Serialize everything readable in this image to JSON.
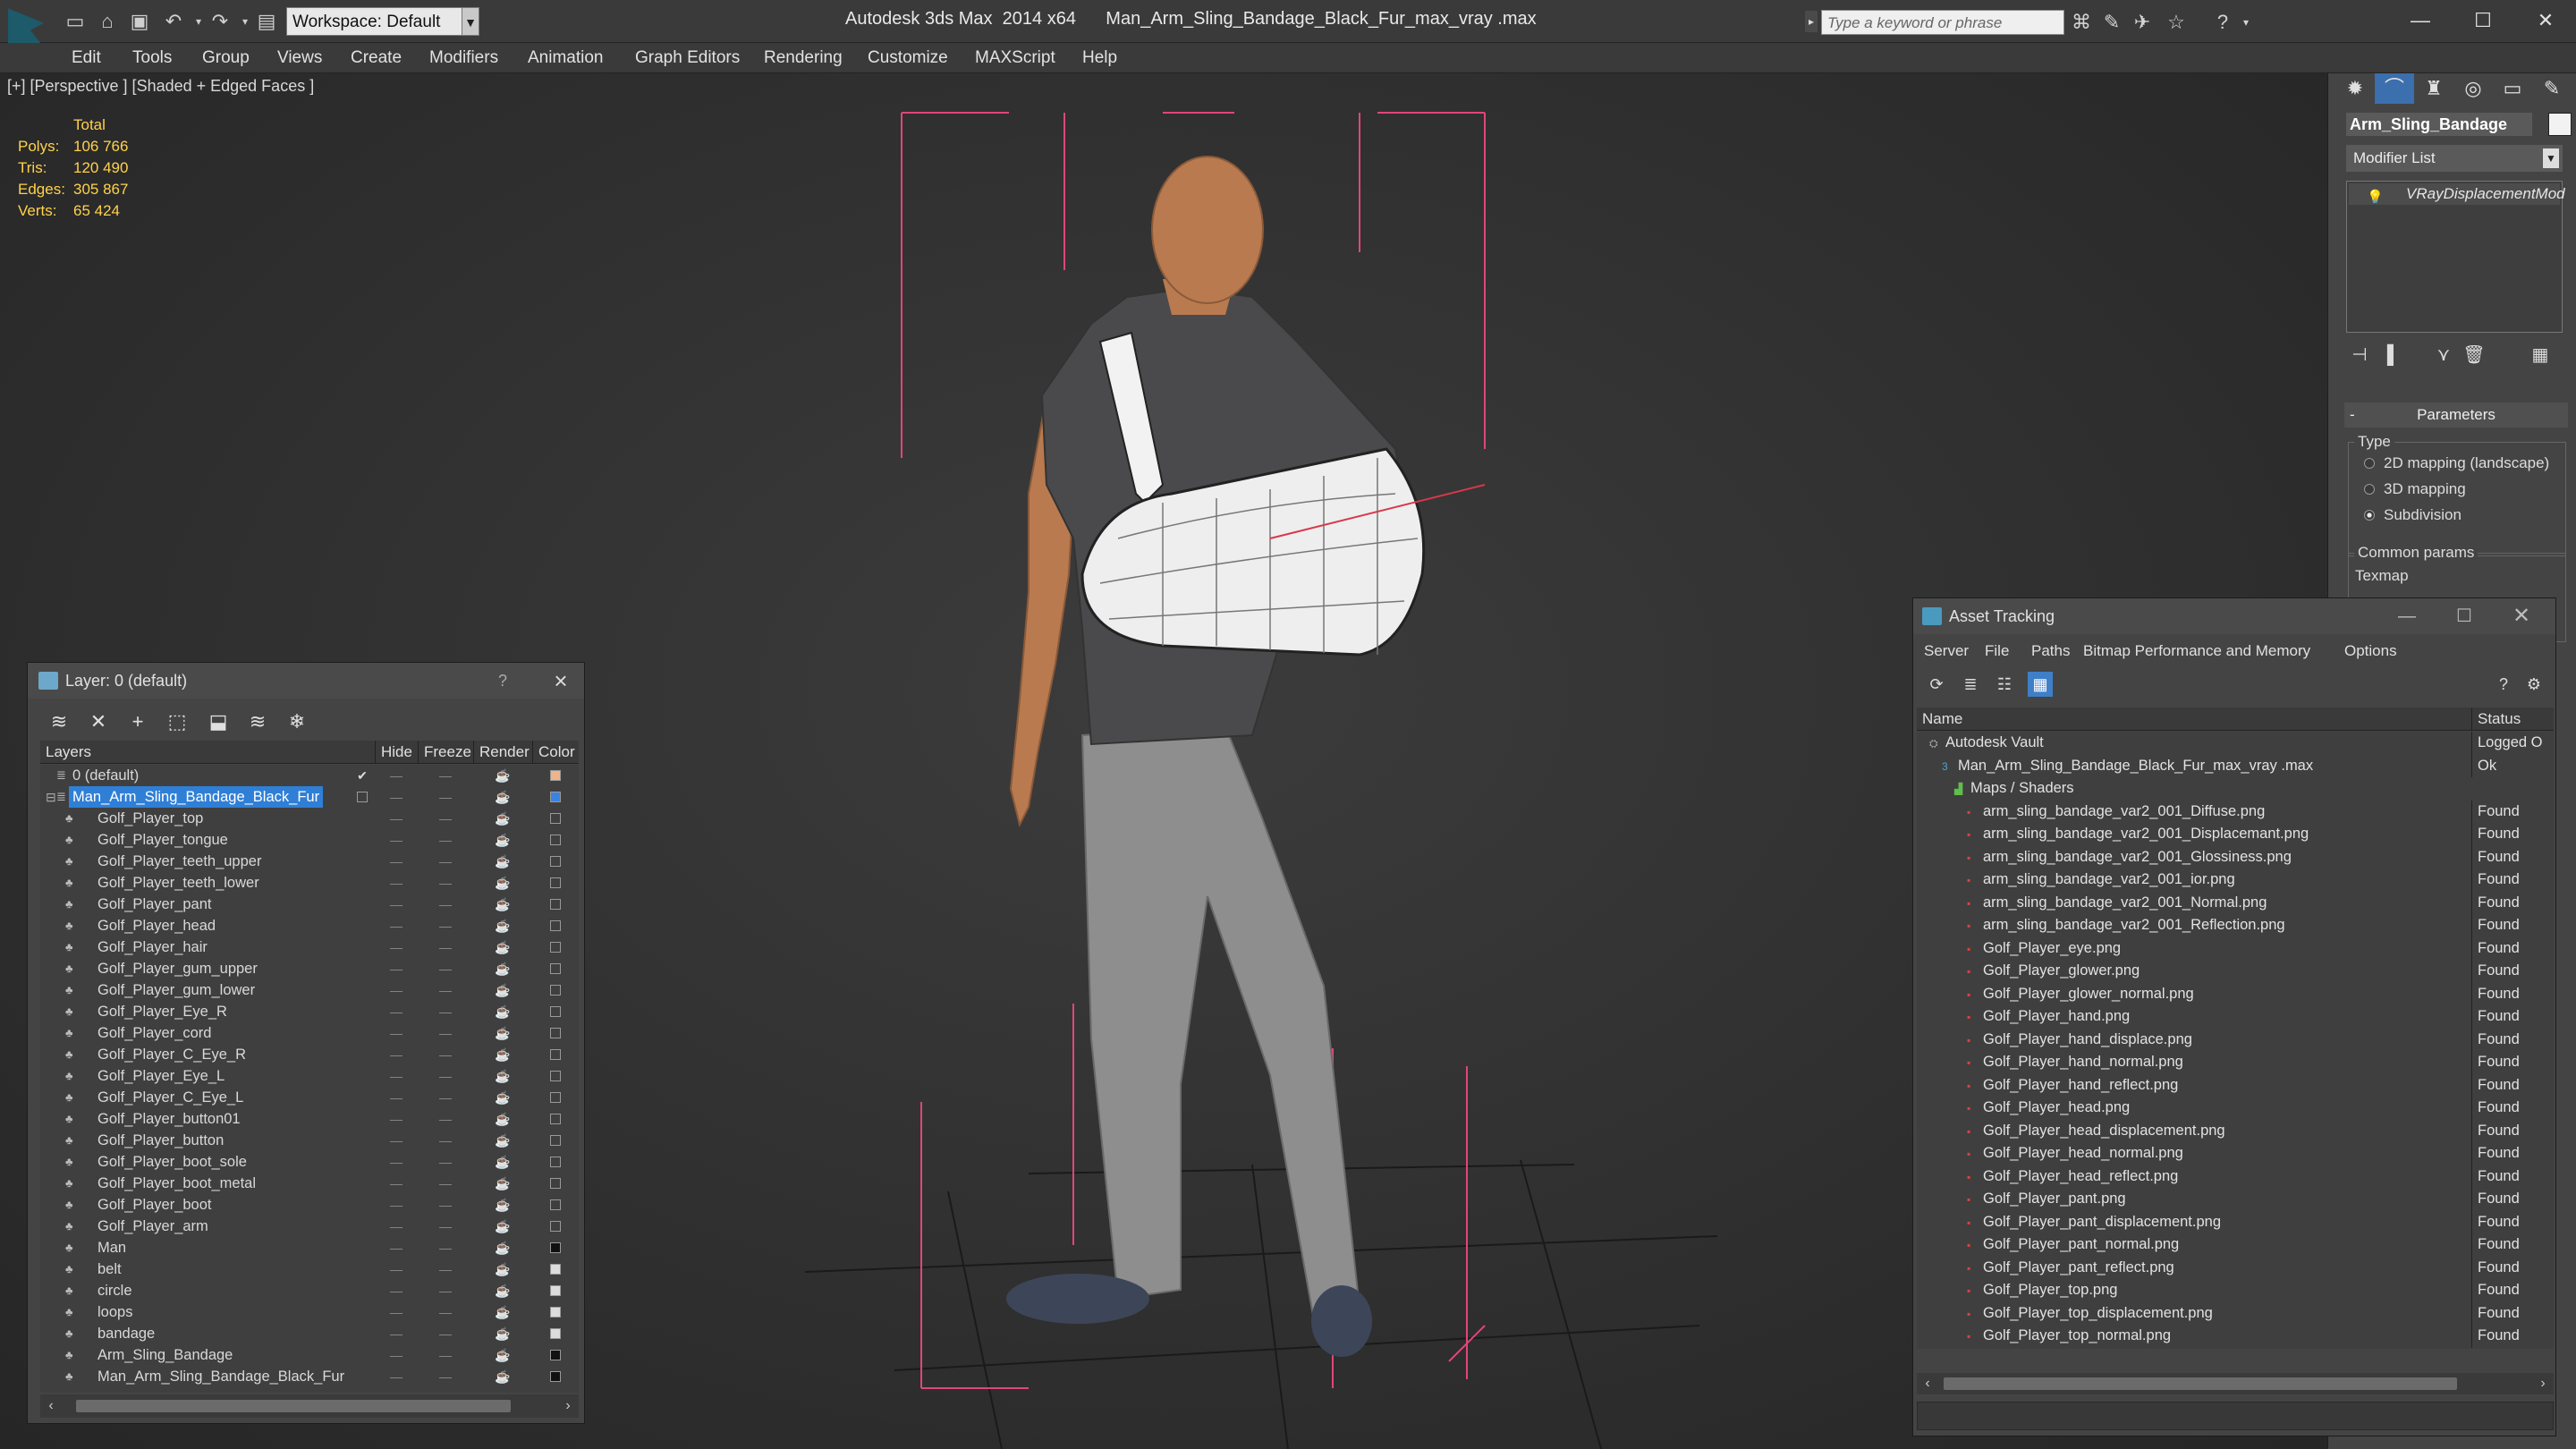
{
  "titlebar": {
    "workspace": "Workspace: Default",
    "app_name": "Autodesk 3ds Max  2014 x64",
    "file_name": "Man_Arm_Sling_Bandage_Black_Fur_max_vray .max",
    "search_placeholder": "Type a keyword or phrase"
  },
  "menubar": [
    "Edit",
    "Tools",
    "Group",
    "Views",
    "Create",
    "Modifiers",
    "Animation",
    "Graph Editors",
    "Rendering",
    "Customize",
    "MAXScript",
    "Help"
  ],
  "viewport": {
    "label": "[+] [Perspective ] [Shaded + Edged Faces ]",
    "stats": {
      "total": "Total",
      "rows": [
        {
          "k": "Polys:",
          "v": "106 766"
        },
        {
          "k": "Tris:",
          "v": "120 490"
        },
        {
          "k": "Edges:",
          "v": "305 867"
        },
        {
          "k": "Verts:",
          "v": "65 424"
        }
      ]
    }
  },
  "command_panel": {
    "object_name": "Arm_Sling_Bandage",
    "modifier_list": "Modifier List",
    "modifier": "VRayDisplacementMod",
    "rollout": "Parameters",
    "type_group": "Type",
    "types": [
      "2D mapping (landscape)",
      "3D mapping",
      "Subdivision"
    ],
    "selected_type": "Subdivision",
    "common_group": "Common params",
    "texmap": "Texmap"
  },
  "layer_window": {
    "title": "Layer: 0 (default)",
    "help": "?",
    "columns": {
      "layers": "Layers",
      "hide": "Hide",
      "freeze": "Freeze",
      "render": "Render",
      "color": "Color"
    },
    "rows": [
      {
        "name": "0 (default)",
        "level": 0,
        "kind": "layer",
        "color": "#f0b48a",
        "check": true
      },
      {
        "name": "Man_Arm_Sling_Bandage_Black_Fur",
        "level": 0,
        "kind": "layer",
        "color": "#3b82e0",
        "selected": true
      },
      {
        "name": "Golf_Player_top",
        "level": 1,
        "color": "#3f3f3f"
      },
      {
        "name": "Golf_Player_tongue",
        "level": 1,
        "color": "#3f3f3f"
      },
      {
        "name": "Golf_Player_teeth_upper",
        "level": 1,
        "color": "#3f3f3f"
      },
      {
        "name": "Golf_Player_teeth_lower",
        "level": 1,
        "color": "#3f3f3f"
      },
      {
        "name": "Golf_Player_pant",
        "level": 1,
        "color": "#3f3f3f"
      },
      {
        "name": "Golf_Player_head",
        "level": 1,
        "color": "#3f3f3f"
      },
      {
        "name": "Golf_Player_hair",
        "level": 1,
        "color": "#3f3f3f"
      },
      {
        "name": "Golf_Player_gum_upper",
        "level": 1,
        "color": "#3f3f3f"
      },
      {
        "name": "Golf_Player_gum_lower",
        "level": 1,
        "color": "#3f3f3f"
      },
      {
        "name": "Golf_Player_Eye_R",
        "level": 1,
        "color": "#3f3f3f"
      },
      {
        "name": "Golf_Player_cord",
        "level": 1,
        "color": "#3f3f3f"
      },
      {
        "name": "Golf_Player_C_Eye_R",
        "level": 1,
        "color": "#3f3f3f"
      },
      {
        "name": "Golf_Player_Eye_L",
        "level": 1,
        "color": "#3f3f3f"
      },
      {
        "name": "Golf_Player_C_Eye_L",
        "level": 1,
        "color": "#3f3f3f"
      },
      {
        "name": "Golf_Player_button01",
        "level": 1,
        "color": "#3f3f3f"
      },
      {
        "name": "Golf_Player_button",
        "level": 1,
        "color": "#3f3f3f"
      },
      {
        "name": "Golf_Player_boot_sole",
        "level": 1,
        "color": "#3f3f3f"
      },
      {
        "name": "Golf_Player_boot_metal",
        "level": 1,
        "color": "#3f3f3f"
      },
      {
        "name": "Golf_Player_boot",
        "level": 1,
        "color": "#3f3f3f"
      },
      {
        "name": "Golf_Player_arm",
        "level": 1,
        "color": "#3f3f3f"
      },
      {
        "name": "Man",
        "level": 1,
        "color": "#111111"
      },
      {
        "name": "belt",
        "level": 1,
        "color": "#dcdcdc"
      },
      {
        "name": "circle",
        "level": 1,
        "color": "#dcdcdc"
      },
      {
        "name": "loops",
        "level": 1,
        "color": "#dcdcdc"
      },
      {
        "name": "bandage",
        "level": 1,
        "color": "#dcdcdc"
      },
      {
        "name": "Arm_Sling_Bandage",
        "level": 1,
        "color": "#111111"
      },
      {
        "name": "Man_Arm_Sling_Bandage_Black_Fur",
        "level": 1,
        "color": "#111111"
      }
    ]
  },
  "asset_window": {
    "title": "Asset Tracking",
    "menu": [
      "Server",
      "File",
      "Paths",
      "Bitmap Performance and Memory",
      "Options"
    ],
    "columns": {
      "name": "Name",
      "status": "Status"
    },
    "rows": [
      {
        "name": "Autodesk Vault",
        "status": "Logged O",
        "level": 0,
        "icon": "vault"
      },
      {
        "name": "Man_Arm_Sling_Bandage_Black_Fur_max_vray .max",
        "status": "Ok",
        "level": 1,
        "icon": "max"
      },
      {
        "name": "Maps / Shaders",
        "status": "",
        "level": 2,
        "icon": "folder"
      },
      {
        "name": "arm_sling_bandage_var2_001_Diffuse.png",
        "status": "Found",
        "level": 3,
        "icon": "png"
      },
      {
        "name": "arm_sling_bandage_var2_001_Displacemant.png",
        "status": "Found",
        "level": 3,
        "icon": "png"
      },
      {
        "name": "arm_sling_bandage_var2_001_Glossiness.png",
        "status": "Found",
        "level": 3,
        "icon": "png"
      },
      {
        "name": "arm_sling_bandage_var2_001_ior.png",
        "status": "Found",
        "level": 3,
        "icon": "png"
      },
      {
        "name": "arm_sling_bandage_var2_001_Normal.png",
        "status": "Found",
        "level": 3,
        "icon": "png"
      },
      {
        "name": "arm_sling_bandage_var2_001_Reflection.png",
        "status": "Found",
        "level": 3,
        "icon": "png"
      },
      {
        "name": "Golf_Player_eye.png",
        "status": "Found",
        "level": 3,
        "icon": "png"
      },
      {
        "name": "Golf_Player_glower.png",
        "status": "Found",
        "level": 3,
        "icon": "png"
      },
      {
        "name": "Golf_Player_glower_normal.png",
        "status": "Found",
        "level": 3,
        "icon": "png"
      },
      {
        "name": "Golf_Player_hand.png",
        "status": "Found",
        "level": 3,
        "icon": "png"
      },
      {
        "name": "Golf_Player_hand_displace.png",
        "status": "Found",
        "level": 3,
        "icon": "png"
      },
      {
        "name": "Golf_Player_hand_normal.png",
        "status": "Found",
        "level": 3,
        "icon": "png"
      },
      {
        "name": "Golf_Player_hand_reflect.png",
        "status": "Found",
        "level": 3,
        "icon": "png"
      },
      {
        "name": "Golf_Player_head.png",
        "status": "Found",
        "level": 3,
        "icon": "png"
      },
      {
        "name": "Golf_Player_head_displacement.png",
        "status": "Found",
        "level": 3,
        "icon": "png"
      },
      {
        "name": "Golf_Player_head_normal.png",
        "status": "Found",
        "level": 3,
        "icon": "png"
      },
      {
        "name": "Golf_Player_head_reflect.png",
        "status": "Found",
        "level": 3,
        "icon": "png"
      },
      {
        "name": "Golf_Player_pant.png",
        "status": "Found",
        "level": 3,
        "icon": "png"
      },
      {
        "name": "Golf_Player_pant_displacement.png",
        "status": "Found",
        "level": 3,
        "icon": "png"
      },
      {
        "name": "Golf_Player_pant_normal.png",
        "status": "Found",
        "level": 3,
        "icon": "png"
      },
      {
        "name": "Golf_Player_pant_reflect.png",
        "status": "Found",
        "level": 3,
        "icon": "png"
      },
      {
        "name": "Golf_Player_top.png",
        "status": "Found",
        "level": 3,
        "icon": "png"
      },
      {
        "name": "Golf_Player_top_displacement.png",
        "status": "Found",
        "level": 3,
        "icon": "png"
      },
      {
        "name": "Golf_Player_top_normal.png",
        "status": "Found",
        "level": 3,
        "icon": "png"
      }
    ]
  },
  "colors": {
    "selection": "#2f7fd6",
    "stats_text": "#ffd24a",
    "bbox_lines": "#e0467a",
    "skin": "#b97a4f",
    "shirt": "#4a4a4c",
    "pants": "#8e8e8e"
  }
}
